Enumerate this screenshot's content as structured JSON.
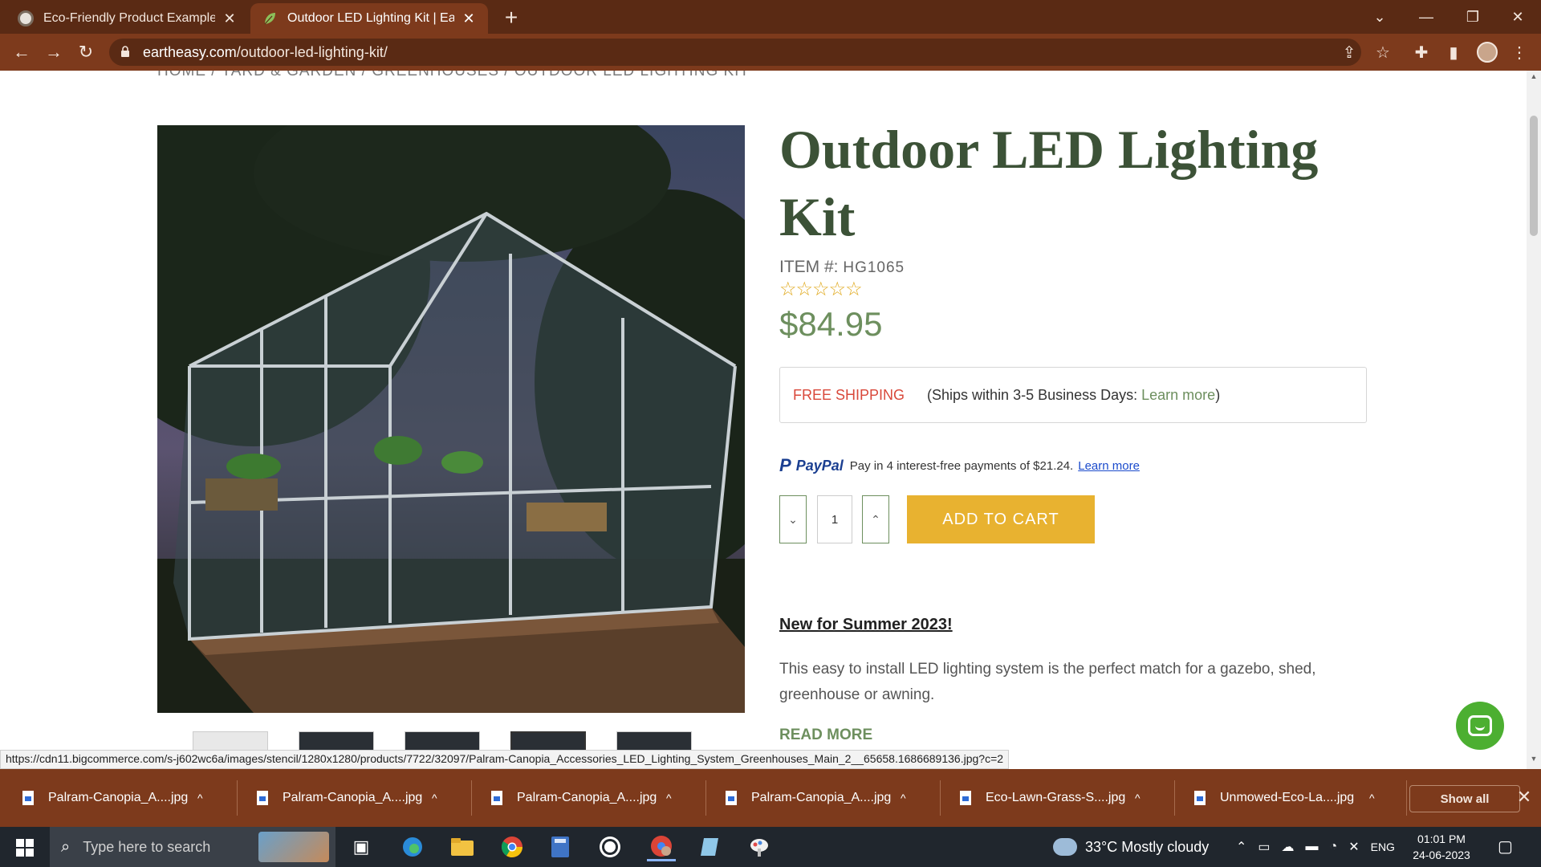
{
  "browser": {
    "tabs": [
      {
        "title": "Eco-Friendly Product Examples",
        "active": false
      },
      {
        "title": "Outdoor LED Lighting Kit | Earthe",
        "active": true
      }
    ],
    "url_host": "eartheasy.com",
    "url_path": "/outdoor-led-lighting-kit/"
  },
  "page": {
    "breadcrumb": "HOME / YARD & GARDEN / GREENHOUSES / OUTDOOR LED LIGHTING KIT",
    "product_title": "Outdoor LED Lighting Kit",
    "item_label": "ITEM #:",
    "item_code": "HG1065",
    "rating_stars": "☆☆☆☆☆",
    "price": "$84.95",
    "shipping": {
      "free_label": "FREE SHIPPING",
      "note_prefix": "(Ships within 3-5 Business Days: ",
      "learn_more": "Learn more",
      "note_suffix": ")"
    },
    "paypal": {
      "brand": "PayPal",
      "text": "Pay in 4 interest-free payments of $21.24.",
      "learn_more": "Learn more"
    },
    "quantity": "1",
    "add_to_cart": "ADD TO CART",
    "new_heading": "New for Summer 2023!",
    "description": "This easy to install LED lighting system is the perfect match for a gazebo, shed, greenhouse or awning.",
    "read_more": "READ MORE"
  },
  "status_url": "https://cdn11.bigcommerce.com/s-j602wc6a/images/stencil/1280x1280/products/7722/32097/Palram-Canopia_Accessories_LED_Lighting_System_Greenhouses_Main_2__65658.1686689136.jpg?c=2",
  "downloads": {
    "items": [
      "Palram-Canopia_A....jpg",
      "Palram-Canopia_A....jpg",
      "Palram-Canopia_A....jpg",
      "Palram-Canopia_A....jpg",
      "Eco-Lawn-Grass-S....jpg",
      "Unmowed-Eco-La....jpg"
    ],
    "show_all": "Show all"
  },
  "taskbar": {
    "search_placeholder": "Type here to search",
    "weather": "33°C  Mostly cloudy",
    "language": "ENG",
    "time": "01:01 PM",
    "date": "24-06-2023"
  },
  "colors": {
    "title_green": "#3c5237",
    "price_green": "#6d8f5e",
    "cart_yellow": "#e8b230",
    "free_ship_red": "#d9483a",
    "browser_brown": "#7d3a1c"
  }
}
